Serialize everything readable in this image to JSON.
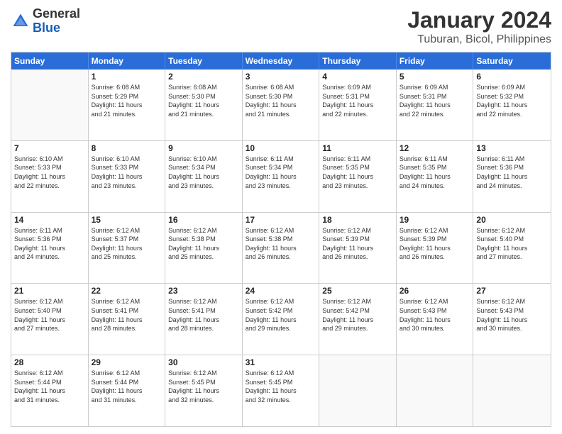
{
  "logo": {
    "text_general": "General",
    "text_blue": "Blue"
  },
  "title": "January 2024",
  "subtitle": "Tuburan, Bicol, Philippines",
  "header": {
    "days": [
      "Sunday",
      "Monday",
      "Tuesday",
      "Wednesday",
      "Thursday",
      "Friday",
      "Saturday"
    ]
  },
  "weeks": [
    [
      {
        "day": "",
        "info": ""
      },
      {
        "day": "1",
        "info": "Sunrise: 6:08 AM\nSunset: 5:29 PM\nDaylight: 11 hours\nand 21 minutes."
      },
      {
        "day": "2",
        "info": "Sunrise: 6:08 AM\nSunset: 5:30 PM\nDaylight: 11 hours\nand 21 minutes."
      },
      {
        "day": "3",
        "info": "Sunrise: 6:08 AM\nSunset: 5:30 PM\nDaylight: 11 hours\nand 21 minutes."
      },
      {
        "day": "4",
        "info": "Sunrise: 6:09 AM\nSunset: 5:31 PM\nDaylight: 11 hours\nand 22 minutes."
      },
      {
        "day": "5",
        "info": "Sunrise: 6:09 AM\nSunset: 5:31 PM\nDaylight: 11 hours\nand 22 minutes."
      },
      {
        "day": "6",
        "info": "Sunrise: 6:09 AM\nSunset: 5:32 PM\nDaylight: 11 hours\nand 22 minutes."
      }
    ],
    [
      {
        "day": "7",
        "info": "Sunrise: 6:10 AM\nSunset: 5:33 PM\nDaylight: 11 hours\nand 22 minutes."
      },
      {
        "day": "8",
        "info": "Sunrise: 6:10 AM\nSunset: 5:33 PM\nDaylight: 11 hours\nand 23 minutes."
      },
      {
        "day": "9",
        "info": "Sunrise: 6:10 AM\nSunset: 5:34 PM\nDaylight: 11 hours\nand 23 minutes."
      },
      {
        "day": "10",
        "info": "Sunrise: 6:11 AM\nSunset: 5:34 PM\nDaylight: 11 hours\nand 23 minutes."
      },
      {
        "day": "11",
        "info": "Sunrise: 6:11 AM\nSunset: 5:35 PM\nDaylight: 11 hours\nand 23 minutes."
      },
      {
        "day": "12",
        "info": "Sunrise: 6:11 AM\nSunset: 5:35 PM\nDaylight: 11 hours\nand 24 minutes."
      },
      {
        "day": "13",
        "info": "Sunrise: 6:11 AM\nSunset: 5:36 PM\nDaylight: 11 hours\nand 24 minutes."
      }
    ],
    [
      {
        "day": "14",
        "info": "Sunrise: 6:11 AM\nSunset: 5:36 PM\nDaylight: 11 hours\nand 24 minutes."
      },
      {
        "day": "15",
        "info": "Sunrise: 6:12 AM\nSunset: 5:37 PM\nDaylight: 11 hours\nand 25 minutes."
      },
      {
        "day": "16",
        "info": "Sunrise: 6:12 AM\nSunset: 5:38 PM\nDaylight: 11 hours\nand 25 minutes."
      },
      {
        "day": "17",
        "info": "Sunrise: 6:12 AM\nSunset: 5:38 PM\nDaylight: 11 hours\nand 26 minutes."
      },
      {
        "day": "18",
        "info": "Sunrise: 6:12 AM\nSunset: 5:39 PM\nDaylight: 11 hours\nand 26 minutes."
      },
      {
        "day": "19",
        "info": "Sunrise: 6:12 AM\nSunset: 5:39 PM\nDaylight: 11 hours\nand 26 minutes."
      },
      {
        "day": "20",
        "info": "Sunrise: 6:12 AM\nSunset: 5:40 PM\nDaylight: 11 hours\nand 27 minutes."
      }
    ],
    [
      {
        "day": "21",
        "info": "Sunrise: 6:12 AM\nSunset: 5:40 PM\nDaylight: 11 hours\nand 27 minutes."
      },
      {
        "day": "22",
        "info": "Sunrise: 6:12 AM\nSunset: 5:41 PM\nDaylight: 11 hours\nand 28 minutes."
      },
      {
        "day": "23",
        "info": "Sunrise: 6:12 AM\nSunset: 5:41 PM\nDaylight: 11 hours\nand 28 minutes."
      },
      {
        "day": "24",
        "info": "Sunrise: 6:12 AM\nSunset: 5:42 PM\nDaylight: 11 hours\nand 29 minutes."
      },
      {
        "day": "25",
        "info": "Sunrise: 6:12 AM\nSunset: 5:42 PM\nDaylight: 11 hours\nand 29 minutes."
      },
      {
        "day": "26",
        "info": "Sunrise: 6:12 AM\nSunset: 5:43 PM\nDaylight: 11 hours\nand 30 minutes."
      },
      {
        "day": "27",
        "info": "Sunrise: 6:12 AM\nSunset: 5:43 PM\nDaylight: 11 hours\nand 30 minutes."
      }
    ],
    [
      {
        "day": "28",
        "info": "Sunrise: 6:12 AM\nSunset: 5:44 PM\nDaylight: 11 hours\nand 31 minutes."
      },
      {
        "day": "29",
        "info": "Sunrise: 6:12 AM\nSunset: 5:44 PM\nDaylight: 11 hours\nand 31 minutes."
      },
      {
        "day": "30",
        "info": "Sunrise: 6:12 AM\nSunset: 5:45 PM\nDaylight: 11 hours\nand 32 minutes."
      },
      {
        "day": "31",
        "info": "Sunrise: 6:12 AM\nSunset: 5:45 PM\nDaylight: 11 hours\nand 32 minutes."
      },
      {
        "day": "",
        "info": ""
      },
      {
        "day": "",
        "info": ""
      },
      {
        "day": "",
        "info": ""
      }
    ]
  ]
}
